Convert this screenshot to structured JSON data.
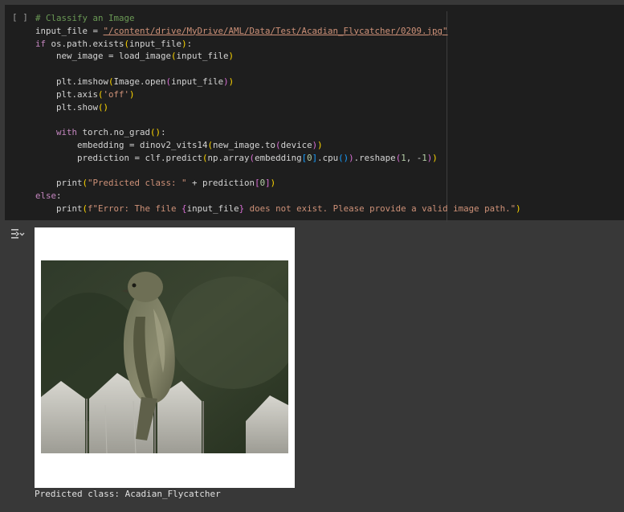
{
  "cell": {
    "run_indicator": "[ ]",
    "lines": [
      "# Classify an Image",
      "input_file = \"/content/drive/MyDrive/AML/Data/Test/Acadian_Flycatcher/0209.jpg\"",
      "if os.path.exists(input_file):",
      "    new_image = load_image(input_file)",
      "",
      "    plt.imshow(Image.open(input_file))",
      "    plt.axis('off')",
      "    plt.show()",
      "",
      "    with torch.no_grad():",
      "        embedding = dinov2_vits14(new_image.to(device))",
      "        prediction = clf.predict(np.array(embedding[0].cpu()).reshape(1, -1))",
      "",
      "    print(\"Predicted class: \" + prediction[0])",
      "else:",
      "    print(f\"Error: The file {input_file} does not exist. Please provide a valid image path.\")"
    ]
  },
  "output": {
    "icon": "output-toggle-icon",
    "image_alt": "Acadian Flycatcher perched on a wooden fence",
    "text": "Predicted class: Acadian_Flycatcher"
  },
  "colors": {
    "page_bg": "#383838",
    "cell_bg": "#1e1e1e",
    "comment": "#6a9955",
    "keyword": "#c586c0",
    "function": "#dcdcaa",
    "string": "#ce9178",
    "number": "#b5cea8"
  }
}
